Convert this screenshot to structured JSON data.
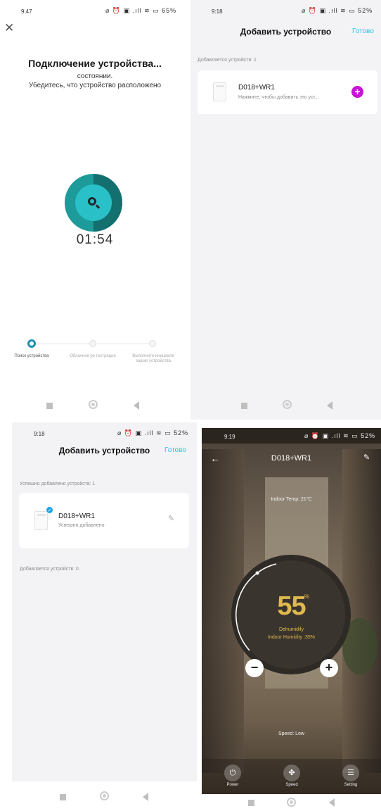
{
  "panel1": {
    "status": {
      "time": "9:47",
      "icons": "⌀ ⏰ ▣ .ıll ≋ ▭ 65%"
    },
    "title": "Подключение устройства...",
    "line1": "состоянии.",
    "line2": "Убедитесь, что устройство расположено",
    "timer": "01:54",
    "steps": [
      {
        "label": "Поиск устройства"
      },
      {
        "label": "Облачная ре гистрация"
      },
      {
        "label": "Выполните инициали зацию устройства"
      }
    ]
  },
  "panel2": {
    "status": {
      "time": "9:18",
      "icons": "⌀ ⏰ ▣ .ıll ≋ ▭ 52%"
    },
    "title": "Добавить устройство",
    "done": "Готово",
    "section": "Добавляется устройств: 1",
    "device": {
      "name": "D018+WR1",
      "note": "Нажмите, чтобы добавить это уст..."
    }
  },
  "panel3": {
    "status": {
      "time": "9:18",
      "icons": "⌀ ⏰ ▣ .ıll ≋ ▭ 52%"
    },
    "title": "Добавить устройство",
    "done": "Готово",
    "section_success": "Успешно добавлено устройств: 1",
    "device": {
      "name": "D018+WR1",
      "note": "Успешно добавлено"
    },
    "section_adding": "Добавляется устройств: 0"
  },
  "panel4": {
    "status": {
      "time": "9:19",
      "icons": "⌀ ⏰ ▣ .ıll ≋ ▭ 52%"
    },
    "title": "D018+WR1",
    "indoor_temp": "Indoor Temp: 21℃",
    "value": "55",
    "unit_top": "%",
    "unit_bottom": "",
    "mode": "Dehumidify",
    "humidity": "Indoor Humidity :35%",
    "speed": "Speed: Low",
    "controls": [
      {
        "label": "Power",
        "icon": "power-icon"
      },
      {
        "label": "Speed",
        "icon": "fan-icon"
      },
      {
        "label": "Setting",
        "icon": "settings-icon"
      }
    ]
  }
}
